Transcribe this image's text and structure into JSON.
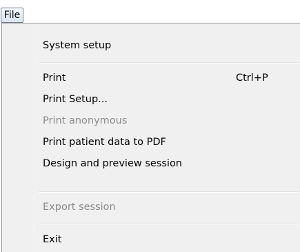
{
  "menubar": {
    "file_label": "File"
  },
  "menu": {
    "items": [
      {
        "label": "System setup",
        "shortcut": "",
        "enabled": true
      },
      {
        "label": "Print",
        "shortcut": "Ctrl+P",
        "enabled": true
      },
      {
        "label": "Print Setup...",
        "shortcut": "",
        "enabled": true
      },
      {
        "label": "Print anonymous",
        "shortcut": "",
        "enabled": false
      },
      {
        "label": "Print patient data to PDF",
        "shortcut": "",
        "enabled": true
      },
      {
        "label": "Design and preview session",
        "shortcut": "",
        "enabled": true
      },
      {
        "label": "Export session",
        "shortcut": "",
        "enabled": false
      },
      {
        "label": "Exit",
        "shortcut": "",
        "enabled": true
      }
    ]
  },
  "colors": {
    "panel_background": "#f0f0f0",
    "disabled_text": "#8b8b8b",
    "menubar_border": "#6f7b8b"
  }
}
